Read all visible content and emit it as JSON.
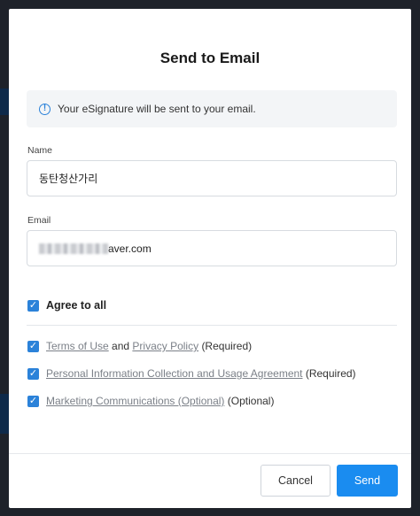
{
  "dialog": {
    "title": "Send to Email",
    "info_icon": "info-icon",
    "info_text": "Your eSignature will be sent to your email."
  },
  "form": {
    "name_label": "Name",
    "name_value": "동탄청산가리",
    "email_label": "Email",
    "email_value_visible": "aver.com"
  },
  "consent": {
    "agree_all_label": "Agree to all",
    "items": [
      {
        "links": [
          "Terms of Use",
          "Privacy Policy"
        ],
        "connector": "and",
        "suffix": "(Required)",
        "checked": true
      },
      {
        "links": [
          "Personal Information Collection and Usage Agreement"
        ],
        "suffix": "(Required)",
        "checked": true
      },
      {
        "links": [
          "Marketing Communications (Optional)"
        ],
        "suffix": "(Optional)",
        "checked": true
      }
    ]
  },
  "footer": {
    "cancel_label": "Cancel",
    "send_label": "Send"
  },
  "colors": {
    "accent": "#1a8cf0",
    "checkbox": "#2b82d9",
    "link": "#7b8088"
  }
}
